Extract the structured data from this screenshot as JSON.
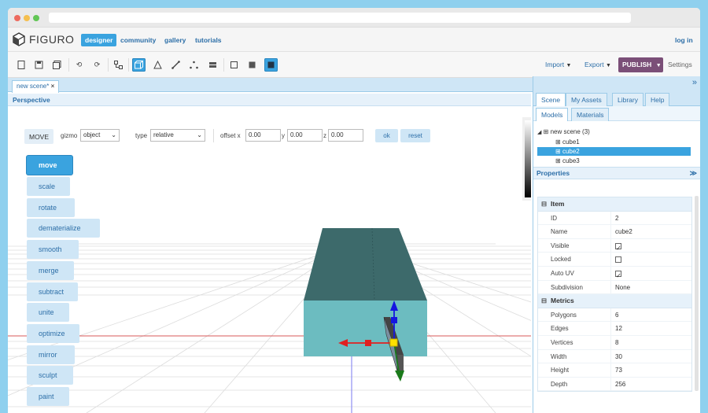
{
  "nav": {
    "logo": "FIGURO",
    "links": [
      "designer",
      "community",
      "gallery",
      "tutorials"
    ],
    "login": "log in"
  },
  "toolbar": {
    "import": "Import",
    "export": "Export",
    "publish": "PUBLISH",
    "settings": "Settings"
  },
  "doc_tab": "new scene*",
  "viewport": {
    "title": "Perspective",
    "mode": "MOVE",
    "gizmo_label": "gizmo",
    "gizmo_value": "object",
    "type_label": "type",
    "type_value": "relative",
    "offset_label": "offset x",
    "y_label": "y",
    "z_label": "z",
    "x_value": "0.00",
    "y_value": "0.00",
    "z_value": "0.00",
    "ok": "ok",
    "reset": "reset",
    "operations": [
      "move",
      "scale",
      "rotate",
      "dematerialize",
      "smooth",
      "merge",
      "subtract",
      "unite",
      "optimize",
      "mirror",
      "sculpt",
      "paint"
    ],
    "active_operation": "move"
  },
  "panel": {
    "tabs": [
      "Scene",
      "My Assets",
      "Library",
      "Help"
    ],
    "subtabs": [
      "Models",
      "Materials"
    ],
    "tree": {
      "root": "new scene (3)",
      "items": [
        "cube1",
        "cube2",
        "cube3"
      ],
      "selected": "cube2"
    },
    "properties_title": "Properties",
    "groups": {
      "item": {
        "title": "Item",
        "rows": [
          {
            "k": "ID",
            "v": "2"
          },
          {
            "k": "Name",
            "v": "cube2"
          },
          {
            "k": "Visible",
            "v": "checked"
          },
          {
            "k": "Locked",
            "v": "unchecked"
          },
          {
            "k": "Auto UV",
            "v": "checked"
          },
          {
            "k": "Subdivision",
            "v": "None"
          }
        ]
      },
      "metrics": {
        "title": "Metrics",
        "rows": [
          {
            "k": "Polygons",
            "v": "6"
          },
          {
            "k": "Edges",
            "v": "12"
          },
          {
            "k": "Vertices",
            "v": "8"
          },
          {
            "k": "Width",
            "v": "30"
          },
          {
            "k": "Height",
            "v": "73"
          },
          {
            "k": "Depth",
            "v": "256"
          }
        ]
      }
    }
  },
  "colors": {
    "accent": "#3aa3df",
    "accent_light": "#cfe6f6",
    "publish": "#7b4f78",
    "link": "#2d6fa8",
    "box_top": "#3d6a6b",
    "box_front": "#6cbcc0",
    "grid": "#dcdcdc",
    "axis_red": "#d9585a"
  },
  "icons": {
    "toolbar": [
      "new-file-icon",
      "save-icon",
      "save-as-icon",
      "undo-icon",
      "redo-icon",
      "hierarchy-icon",
      "cube-select-icon",
      "triangle-icon",
      "edge-icon",
      "vertex-icon",
      "grid-icon",
      "square-outline-icon",
      "square-filled-icon",
      "square-active-icon"
    ]
  }
}
